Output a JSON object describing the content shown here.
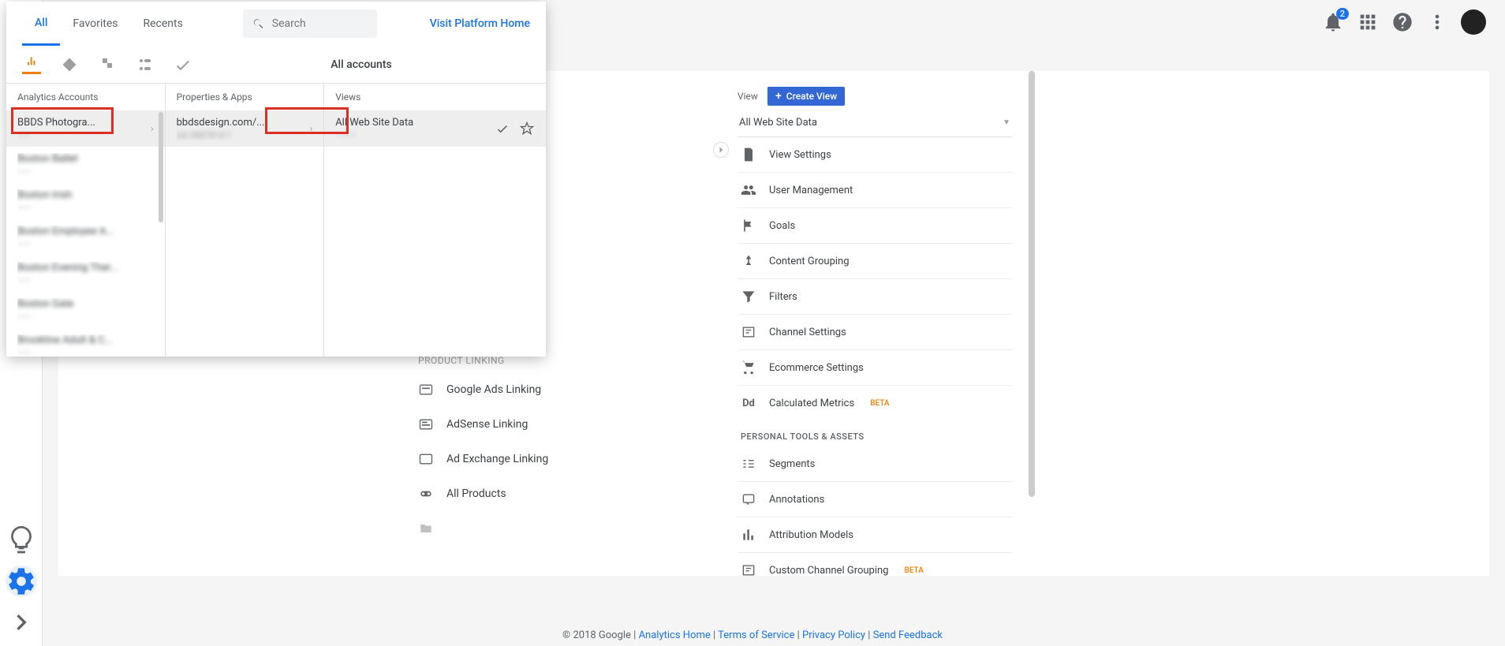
{
  "header": {
    "notif_count": "2"
  },
  "picker": {
    "tabs": {
      "all": "All",
      "favorites": "Favorites",
      "recents": "Recents"
    },
    "search_placeholder": "Search",
    "visit_home": "Visit Platform Home",
    "all_accounts": "All accounts",
    "col_accounts": "Analytics Accounts",
    "col_properties": "Properties & Apps",
    "col_views": "Views",
    "account_selected": "BBDS Photogra...",
    "accounts_blurred": [
      "Boston Ballet",
      "——",
      "Boston Irish",
      "——",
      "Boston Employee A...",
      "——",
      "Boston Evening Ther...",
      "——",
      "Boston Gate",
      "——",
      "Brookline Adult & C...",
      "——"
    ],
    "property": {
      "name": "bbdsdesign.com/...",
      "sub": "UA-5887814-1"
    },
    "view": {
      "name": "All Web Site Data",
      "sub": "———"
    }
  },
  "product_linking": {
    "header": "PRODUCT LINKING",
    "items": [
      "Google Ads Linking",
      "AdSense Linking",
      "Ad Exchange Linking",
      "All Products"
    ]
  },
  "view_panel": {
    "label": "View",
    "create": "Create View",
    "selected": "All Web Site Data",
    "items": [
      "View Settings",
      "User Management",
      "Goals",
      "Content Grouping",
      "Filters",
      "Channel Settings",
      "Ecommerce Settings"
    ],
    "calc_metrics": "Calculated Metrics",
    "beta": "BETA",
    "personal_header": "PERSONAL TOOLS & ASSETS",
    "personal": [
      "Segments",
      "Annotations",
      "Attribution Models"
    ],
    "custom_channel": "Custom Channel Grouping"
  },
  "footer": {
    "copyright": "© 2018 Google | ",
    "analytics_home": "Analytics Home",
    "sep": " | ",
    "tos": "Terms of Service",
    "privacy": "Privacy Policy",
    "feedback": "Send Feedback"
  }
}
